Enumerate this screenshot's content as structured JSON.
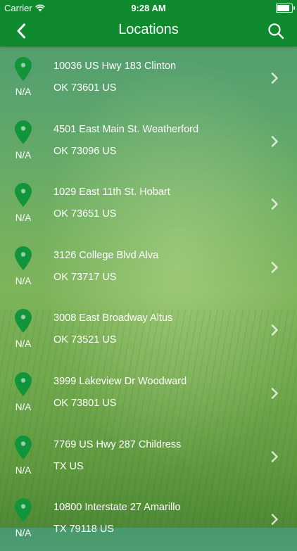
{
  "status_bar": {
    "carrier": "Carrier",
    "time": "9:28 AM",
    "battery_level": 0.95
  },
  "nav": {
    "title": "Locations",
    "back_icon": "chevron-left-icon",
    "search_icon": "search-icon"
  },
  "colors": {
    "bar": "#0f8a2e",
    "pin": "#12943a"
  },
  "locations": [
    {
      "distance": "N/A",
      "line1": "10036 US Hwy 183 Clinton",
      "line2": "OK 73601 US"
    },
    {
      "distance": "N/A",
      "line1": "4501 East Main St. Weatherford",
      "line2": "OK 73096 US"
    },
    {
      "distance": "N/A",
      "line1": "1029 East 11th St. Hobart",
      "line2": "OK 73651 US"
    },
    {
      "distance": "N/A",
      "line1": "3126 College Blvd Alva",
      "line2": "OK 73717 US"
    },
    {
      "distance": "N/A",
      "line1": "3008 East Broadway Altus",
      "line2": "OK 73521 US"
    },
    {
      "distance": "N/A",
      "line1": "3999 Lakeview Dr Woodward",
      "line2": "OK 73801 US"
    },
    {
      "distance": "N/A",
      "line1": "7769 US Hwy 287 Childress",
      "line2": "TX US"
    },
    {
      "distance": "N/A",
      "line1": "10800 Interstate 27 Amarillo",
      "line2": "TX 79118 US"
    }
  ]
}
